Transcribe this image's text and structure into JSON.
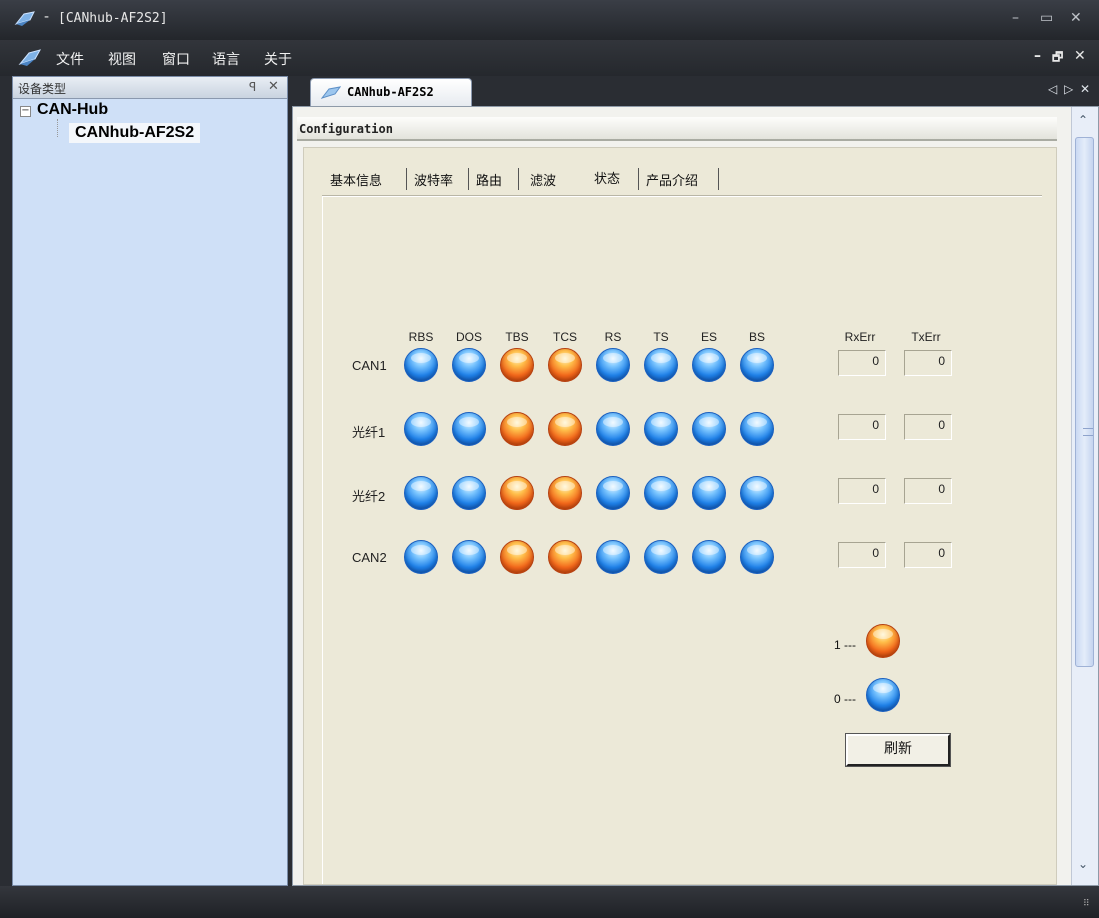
{
  "window": {
    "title": "[CANhub-AF2S2]",
    "dash": "-",
    "controls": {
      "minimize": "–",
      "maximize": "▭",
      "close": "✕"
    }
  },
  "menu": {
    "items": [
      "文件",
      "视图",
      "窗口",
      "语言",
      "关于"
    ],
    "mdi_controls": {
      "minimize": "–",
      "restore": "🗗",
      "close": "✕"
    }
  },
  "left_panel": {
    "title": "设备类型",
    "pin": "ꟼ",
    "close": "✕",
    "tree": {
      "root": "CAN-Hub",
      "expander": "−",
      "children": [
        "CANhub-AF2S2"
      ]
    }
  },
  "document": {
    "tab_label": "CANhub-AF2S2",
    "nav": {
      "prev": "◁",
      "next": "▷",
      "close": "✕"
    },
    "header": "Configuration",
    "scroll": {
      "up": "⌃",
      "down": "⌄"
    }
  },
  "tabs": [
    {
      "label": "基本信息",
      "active": false
    },
    {
      "label": "波特率",
      "active": false
    },
    {
      "label": "路由",
      "active": false
    },
    {
      "label": "滤波",
      "active": false
    },
    {
      "label": "状态",
      "active": true
    },
    {
      "label": "产品介绍",
      "active": false
    }
  ],
  "status": {
    "columns": [
      "RBS",
      "DOS",
      "TBS",
      "TCS",
      "RS",
      "TS",
      "ES",
      "BS"
    ],
    "err_columns": [
      "RxErr",
      "TxErr"
    ],
    "rows": [
      {
        "label": "CAN1",
        "states": [
          0,
          0,
          1,
          1,
          0,
          0,
          0,
          0
        ],
        "rx_err": "0",
        "tx_err": "0"
      },
      {
        "label": "光纤1",
        "states": [
          0,
          0,
          1,
          1,
          0,
          0,
          0,
          0
        ],
        "rx_err": "0",
        "tx_err": "0"
      },
      {
        "label": "光纤2",
        "states": [
          0,
          0,
          1,
          1,
          0,
          0,
          0,
          0
        ],
        "rx_err": "0",
        "tx_err": "0"
      },
      {
        "label": "CAN2",
        "states": [
          0,
          0,
          1,
          1,
          0,
          0,
          0,
          0
        ],
        "rx_err": "0",
        "tx_err": "0"
      }
    ],
    "legend": [
      {
        "label": "1 ---",
        "value": 1,
        "color": "orange"
      },
      {
        "label": "0 ---",
        "value": 0,
        "color": "blue"
      }
    ],
    "refresh_label": "刷新"
  },
  "colors": {
    "led_on": "#f2661a",
    "led_off": "#1e80e8",
    "panel_bg": "#ece9d8",
    "tree_bg": "#cfe0f7"
  }
}
